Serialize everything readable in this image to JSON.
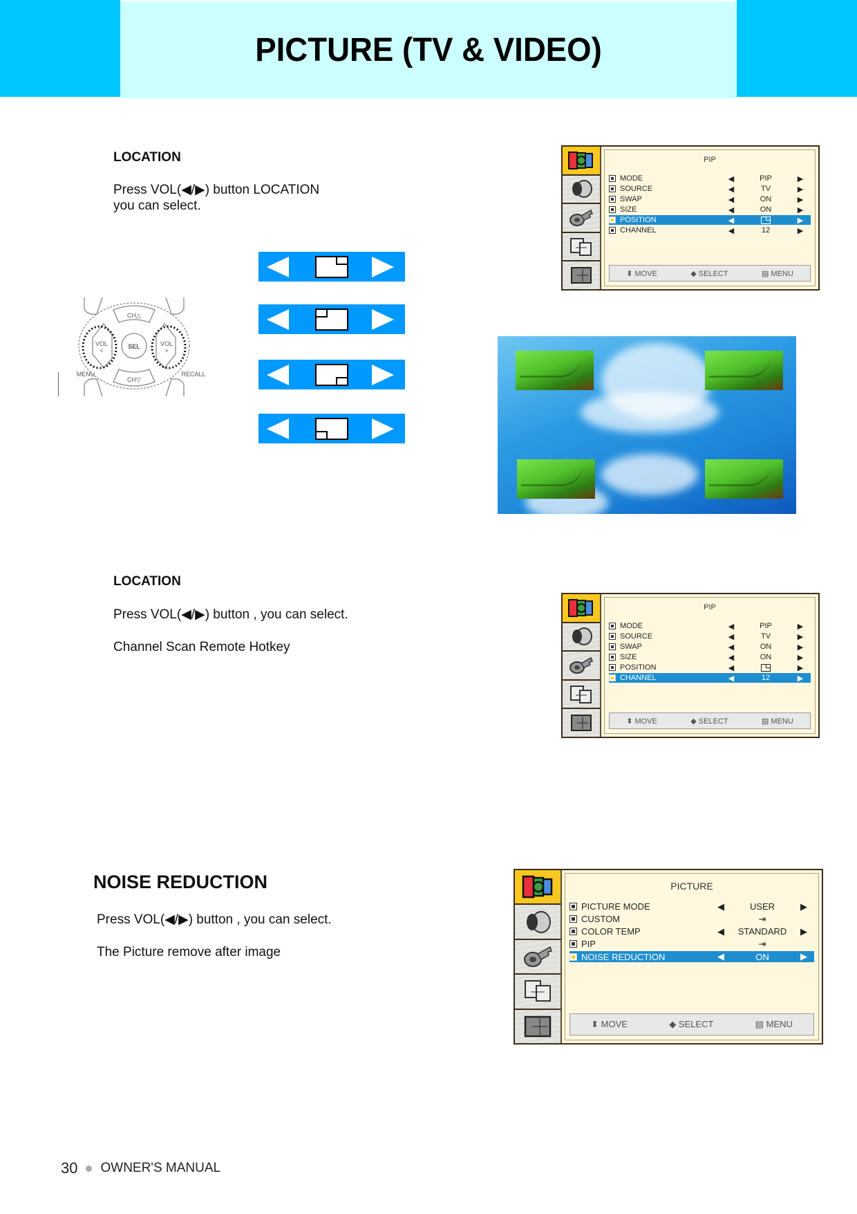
{
  "header": {
    "title": "PICTURE (TV & VIDEO)",
    "accent_color": "#00c8ff",
    "title_bg_color": "#ccffff"
  },
  "section1": {
    "heading": "LOCATION",
    "line1": "Press  VOL(◀/▶) button LOCATION",
    "line2": "you can select.",
    "remote": {
      "buttons": [
        "CH△",
        "VOL <",
        "SEL",
        "VOL >",
        "CH▽",
        "MENU",
        "RECALL"
      ]
    },
    "location_options": [
      {
        "position": "top-right",
        "left_arrow": "left-arrow-icon",
        "right_arrow": "right-arrow-icon"
      },
      {
        "position": "top-left",
        "left_arrow": "left-arrow-icon",
        "right_arrow": "right-arrow-icon"
      },
      {
        "position": "bottom-right",
        "left_arrow": "left-arrow-icon",
        "right_arrow": "right-arrow-icon"
      },
      {
        "position": "bottom-left",
        "left_arrow": "left-arrow-icon",
        "right_arrow": "right-arrow-icon"
      }
    ],
    "osd": {
      "title": "PIP",
      "rows": [
        {
          "label": "MODE",
          "value": "PIP",
          "selected": false
        },
        {
          "label": "SOURCE",
          "value": "TV",
          "selected": false
        },
        {
          "label": "SWAP",
          "value": "ON",
          "selected": false
        },
        {
          "label": "SIZE",
          "value": "ON",
          "selected": false
        },
        {
          "label": "POSITION",
          "value": "",
          "value_icon": "pip-position-icon",
          "selected": true
        },
        {
          "label": "CHANNEL",
          "value": "12",
          "selected": false
        }
      ],
      "footer": {
        "move": "MOVE",
        "select": "SELECT",
        "menu": "MENU"
      }
    }
  },
  "section2": {
    "heading": "LOCATION",
    "line1": "Press  VOL(◀/▶) button , you can select.",
    "line2": "Channel Scan Remote Hotkey",
    "osd": {
      "title": "PIP",
      "rows": [
        {
          "label": "MODE",
          "value": "PIP",
          "selected": false
        },
        {
          "label": "SOURCE",
          "value": "TV",
          "selected": false
        },
        {
          "label": "SWAP",
          "value": "ON",
          "selected": false
        },
        {
          "label": "SIZE",
          "value": "ON",
          "selected": false
        },
        {
          "label": "POSITION",
          "value": "",
          "value_icon": "pip-position-icon",
          "selected": false
        },
        {
          "label": "CHANNEL",
          "value": "12",
          "selected": true
        }
      ],
      "footer": {
        "move": "MOVE",
        "select": "SELECT",
        "menu": "MENU"
      }
    }
  },
  "section3": {
    "heading": "NOISE REDUCTION",
    "line1": "Press  VOL(◀/▶) button , you can select.",
    "line2": "The Picture remove after image",
    "osd": {
      "title": "PICTURE",
      "rows": [
        {
          "label": "PICTURE MODE",
          "value": "USER",
          "arrows": true,
          "selected": false
        },
        {
          "label": "CUSTOM",
          "value": "",
          "value_icon": "enter-icon",
          "arrows": false,
          "selected": false
        },
        {
          "label": "COLOR TEMP",
          "value": "STANDARD",
          "arrows": true,
          "selected": false
        },
        {
          "label": "PIP",
          "value": "",
          "value_icon": "enter-icon",
          "arrows": false,
          "selected": false
        },
        {
          "label": "NOISE REDUCTION",
          "value": "ON",
          "arrows": true,
          "selected": true
        }
      ],
      "footer": {
        "move": "MOVE",
        "select": "SELECT",
        "menu": "MENU"
      }
    }
  },
  "footer": {
    "page_number": "30",
    "label": "OWNER'S MANUAL"
  },
  "glyphs": {
    "left": "◀",
    "right": "▶",
    "updown": "⬍",
    "leftright": "◆",
    "menu": "▤",
    "enter": "⇥"
  }
}
